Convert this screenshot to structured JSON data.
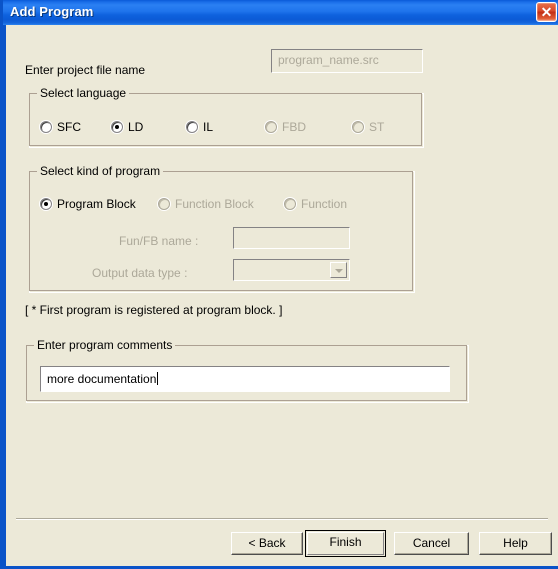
{
  "window": {
    "title": "Add Program",
    "close_icon": "close-icon",
    "close_glyph": "✕"
  },
  "form": {
    "project_file_label": "Enter project file name",
    "project_file_value": "program_name.src"
  },
  "language_group": {
    "caption": "Select language",
    "options": [
      {
        "label": "SFC",
        "checked": false,
        "disabled": false
      },
      {
        "label": "LD",
        "checked": true,
        "disabled": false
      },
      {
        "label": "IL",
        "checked": false,
        "disabled": false
      },
      {
        "label": "FBD",
        "checked": false,
        "disabled": true
      },
      {
        "label": "ST",
        "checked": false,
        "disabled": true
      }
    ]
  },
  "kind_group": {
    "caption": "Select kind of program",
    "options": [
      {
        "label": "Program Block",
        "checked": true,
        "disabled": false
      },
      {
        "label": "Function Block",
        "checked": false,
        "disabled": true
      },
      {
        "label": "Function",
        "checked": false,
        "disabled": true
      }
    ],
    "funfb_name_label": "Fun/FB name :",
    "funfb_name_value": "",
    "output_type_label": "Output data type :",
    "output_type_value": "",
    "dropdown_icon": "chevron-down-icon"
  },
  "note": "[ * First program is registered at program block. ]",
  "comments_group": {
    "caption": "Enter program comments",
    "value": "more documentation"
  },
  "buttons": {
    "back": "< Back",
    "finish": "Finish",
    "cancel": "Cancel",
    "help": "Help"
  }
}
